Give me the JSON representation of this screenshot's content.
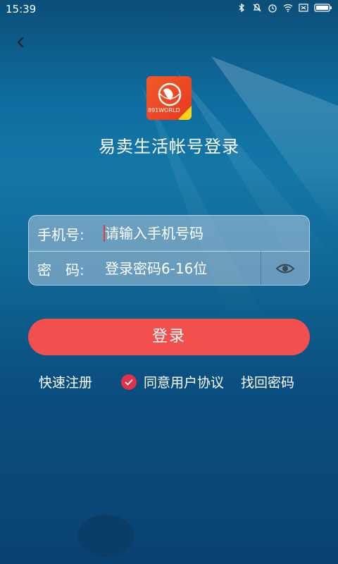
{
  "status_bar": {
    "time": "15:39"
  },
  "header": {
    "app_logo_text": "891WORLD",
    "title": "易卖生活帐号登录"
  },
  "form": {
    "phone_label": "手机号:",
    "phone_placeholder": "请输入手机号码",
    "password_label": "密　码:",
    "password_placeholder": "登录密码6-16位"
  },
  "actions": {
    "login_label": "登录",
    "register_label": "快速注册",
    "agree_label": "同意用户协议",
    "forgot_label": "找回密码"
  },
  "colors": {
    "accent": "#f24f4f",
    "check": "#e0334a"
  },
  "icons": [
    "back-arrow-icon",
    "eye-icon",
    "check-icon",
    "bluetooth-icon",
    "alarm-icon",
    "wifi-icon",
    "battery-icon"
  ]
}
